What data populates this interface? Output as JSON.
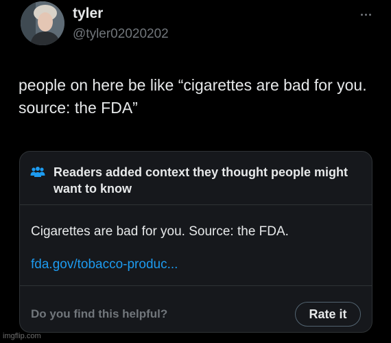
{
  "author": {
    "display_name": "tyler",
    "handle": "@tyler02020202"
  },
  "tweet": {
    "text": "people on here be like “cigarettes are bad for you. source: the FDA”"
  },
  "community_note": {
    "title": "Readers added context they thought people might want to know",
    "body": "Cigarettes are bad for you. Source: the FDA.",
    "link_text": "fda.gov/tobacco-produc...",
    "footer_question": "Do you find this helpful?",
    "rate_button_label": "Rate it",
    "icon": "people-icon"
  },
  "watermark": "imgflip.com",
  "colors": {
    "background": "#000000",
    "text_primary": "#e7e9ea",
    "text_secondary": "#71767b",
    "link": "#1d9bf0",
    "note_background": "#16181c",
    "border": "#2f3336"
  }
}
